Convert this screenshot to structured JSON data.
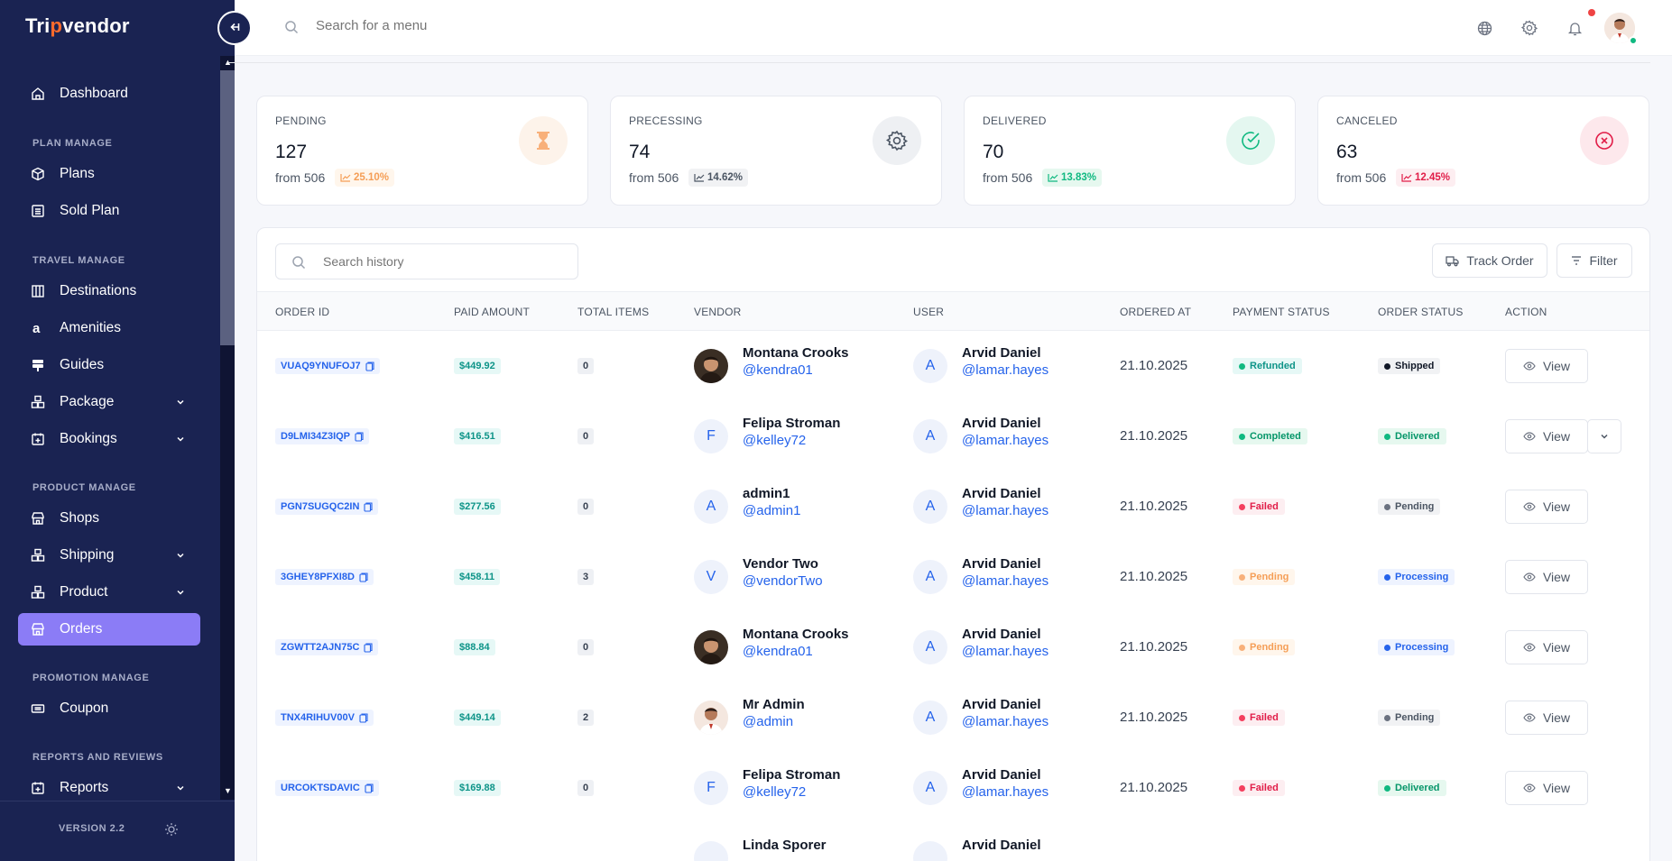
{
  "app": {
    "logo_text_a": "Tri",
    "logo_text_o": "p",
    "logo_text_b": "vendor"
  },
  "sidebar": {
    "items": [
      {
        "label": "Dashboard"
      },
      {
        "label": "Plans"
      },
      {
        "label": "Sold Plan"
      },
      {
        "label": "Destinations"
      },
      {
        "label": "Amenities"
      },
      {
        "label": "Guides"
      },
      {
        "label": "Package"
      },
      {
        "label": "Bookings"
      },
      {
        "label": "Shops"
      },
      {
        "label": "Shipping"
      },
      {
        "label": "Product"
      },
      {
        "label": "Orders"
      },
      {
        "label": "Coupon"
      },
      {
        "label": "Reports"
      }
    ],
    "sections": [
      "PLAN MANAGE",
      "TRAVEL MANAGE",
      "PRODUCT MANAGE",
      "PROMOTION MANAGE",
      "REPORTS AND REVIEWS"
    ],
    "version": "VERSION 2.2"
  },
  "header": {
    "search_placeholder": "Search for a menu"
  },
  "stats": [
    {
      "label": "PENDING",
      "value": "127",
      "from": "from 506",
      "pct": "25.10%",
      "color": "#f59e56"
    },
    {
      "label": "PRECESSING",
      "value": "74",
      "from": "from 506",
      "pct": "14.62%",
      "color": "#4b5563"
    },
    {
      "label": "DELIVERED",
      "value": "70",
      "from": "from 506",
      "pct": "13.83%",
      "color": "#10b981"
    },
    {
      "label": "CANCELED",
      "value": "63",
      "from": "from 506",
      "pct": "12.45%",
      "color": "#e11d48"
    }
  ],
  "toolbar": {
    "search_placeholder": "Search history",
    "track_label": "Track Order",
    "filter_label": "Filter"
  },
  "table": {
    "columns": [
      "ORDER ID",
      "PAID AMOUNT",
      "TOTAL ITEMS",
      "VENDOR",
      "USER",
      "ORDERED AT",
      "PAYMENT STATUS",
      "ORDER STATUS",
      "ACTION"
    ],
    "view_label": "View",
    "rows": [
      {
        "id": "VUAQ9YNUFOJ7",
        "amount": "$449.92",
        "items": "0",
        "vendor": "Montana Crooks",
        "vendor_handle": "@kendra01",
        "vendor_initial": "",
        "user": "Arvid Daniel",
        "user_handle": "@lamar.hayes",
        "user_initial": "A",
        "date": "21.10.2025",
        "payment": "Refunded",
        "order": "Shipped"
      },
      {
        "id": "D9LMI34Z3IQP",
        "amount": "$416.51",
        "items": "0",
        "vendor": "Felipa Stroman",
        "vendor_handle": "@kelley72",
        "vendor_initial": "F",
        "user": "Arvid Daniel",
        "user_handle": "@lamar.hayes",
        "user_initial": "A",
        "date": "21.10.2025",
        "payment": "Completed",
        "order": "Delivered"
      },
      {
        "id": "PGN7SUGQC2IN",
        "amount": "$277.56",
        "items": "0",
        "vendor": "admin1",
        "vendor_handle": "@admin1",
        "vendor_initial": "A",
        "user": "Arvid Daniel",
        "user_handle": "@lamar.hayes",
        "user_initial": "A",
        "date": "21.10.2025",
        "payment": "Failed",
        "order": "Pending"
      },
      {
        "id": "3GHEY8PFXI8D",
        "amount": "$458.11",
        "items": "3",
        "vendor": "Vendor Two",
        "vendor_handle": "@vendorTwo",
        "vendor_initial": "V",
        "user": "Arvid Daniel",
        "user_handle": "@lamar.hayes",
        "user_initial": "A",
        "date": "21.10.2025",
        "payment": "Pending",
        "order": "Processing"
      },
      {
        "id": "ZGWTT2AJN75C",
        "amount": "$88.84",
        "items": "0",
        "vendor": "Montana Crooks",
        "vendor_handle": "@kendra01",
        "vendor_initial": "",
        "user": "Arvid Daniel",
        "user_handle": "@lamar.hayes",
        "user_initial": "A",
        "date": "21.10.2025",
        "payment": "Pending",
        "order": "Processing"
      },
      {
        "id": "TNX4RIHUV00V",
        "amount": "$449.14",
        "items": "2",
        "vendor": "Mr Admin",
        "vendor_handle": "@admin",
        "vendor_initial": "",
        "user": "Arvid Daniel",
        "user_handle": "@lamar.hayes",
        "user_initial": "A",
        "date": "21.10.2025",
        "payment": "Failed",
        "order": "Pending"
      },
      {
        "id": "URCOKTSDAVIC",
        "amount": "$169.88",
        "items": "0",
        "vendor": "Felipa Stroman",
        "vendor_handle": "@kelley72",
        "vendor_initial": "F",
        "user": "Arvid Daniel",
        "user_handle": "@lamar.hayes",
        "user_initial": "A",
        "date": "21.10.2025",
        "payment": "Failed",
        "order": "Delivered"
      },
      {
        "id": "",
        "amount": "",
        "items": "",
        "vendor": "Linda Sporer",
        "vendor_handle": "",
        "vendor_initial": "",
        "user": "Arvid Daniel",
        "user_handle": "",
        "user_initial": "",
        "date": "",
        "payment": "",
        "order": ""
      }
    ]
  }
}
